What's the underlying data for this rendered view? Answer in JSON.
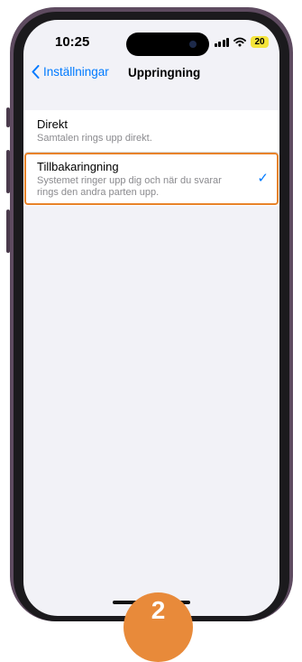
{
  "status_bar": {
    "time": "10:25",
    "battery_level": "20",
    "signal_icon": "cellular-signal-icon",
    "wifi_icon": "wifi-icon"
  },
  "nav": {
    "back_label": "Inställningar",
    "title": "Uppringning"
  },
  "options": [
    {
      "title": "Direkt",
      "subtitle": "Samtalen rings upp direkt.",
      "selected": false
    },
    {
      "title": "Tillbakaringning",
      "subtitle": "Systemet ringer upp dig och när du svarar rings den andra parten upp.",
      "selected": true
    }
  ],
  "marker": {
    "label": "2"
  },
  "colors": {
    "accent": "#007aff",
    "highlight": "#e8832a",
    "battery": "#f4e43a",
    "marker": "#e88a3a"
  }
}
